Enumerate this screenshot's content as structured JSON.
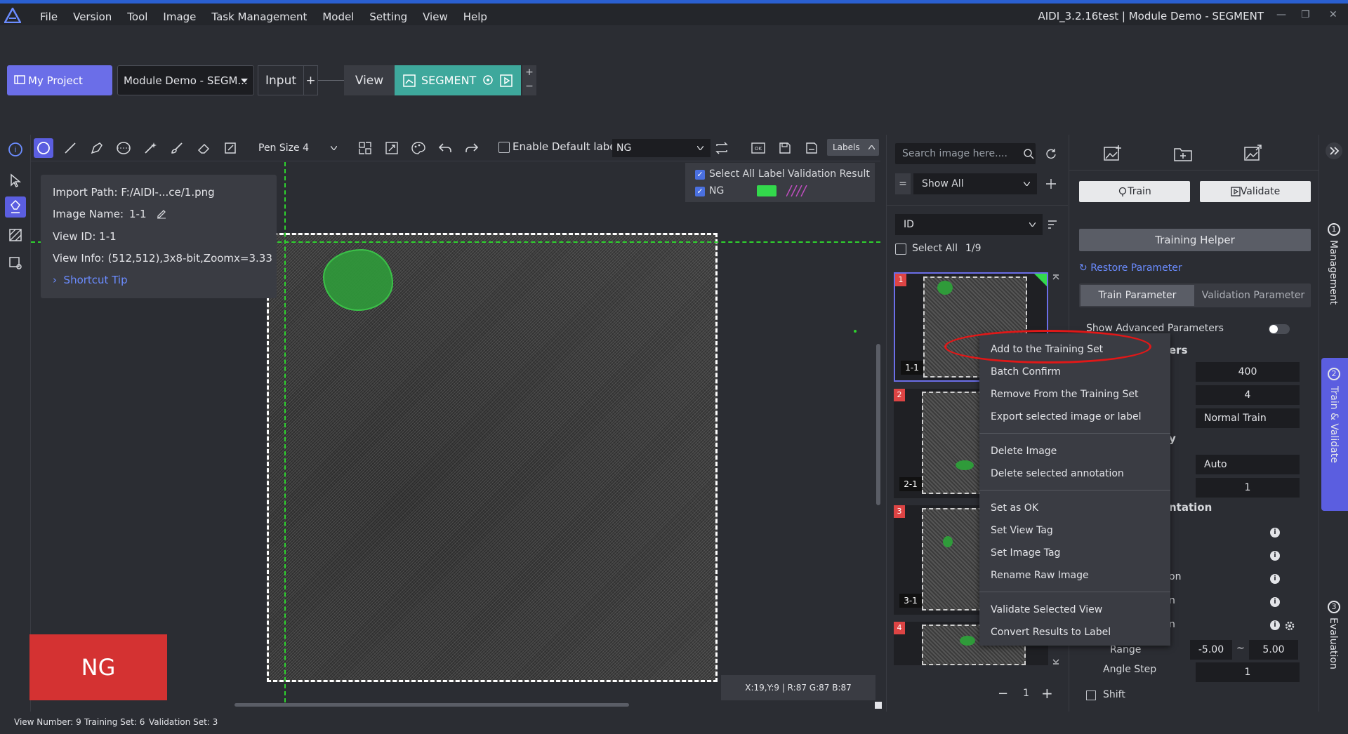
{
  "titlebar": {
    "menu": [
      "File",
      "Version",
      "Tool",
      "Image",
      "Task Management",
      "Model",
      "Setting",
      "View",
      "Help"
    ],
    "window_title": "AIDI_3.2.16test | Module Demo - SEGMENT",
    "min": "—",
    "restore": "❐",
    "close": "✕"
  },
  "project": {
    "my_project": "My Project",
    "module_select": "Module Demo - SEGM...",
    "input": "Input",
    "plus": "+",
    "view": "View",
    "segment": "SEGMENT",
    "zoom_plus": "+",
    "zoom_minus": "−"
  },
  "toolbar": {
    "pen_size": "Pen Size 4",
    "enable_default_label": "Enable Default label",
    "default_label": "NG",
    "labels_button": "Labels"
  },
  "labels_panel": {
    "select_all": "Select All",
    "label": "Label",
    "validation_result": "Validation Result",
    "ng": "NG",
    "label_color": "#33d94c"
  },
  "info": {
    "import_path": "Import Path: F:/AIDI-...ce/1.png",
    "image_name_label": "Image Name:",
    "image_name": "1-1",
    "view_id": "View ID: 1-1",
    "view_info": "View Info: (512,512),3x8-bit,Zoomx=3.33",
    "shortcut_tip": "Shortcut Tip"
  },
  "result_badge": "NG",
  "coords": "X:19,Y:9  |  R:87 G:87 B:87",
  "statusbar": {
    "view_number": "View Number: 9",
    "training_set": "Training Set: 6",
    "validation_set": "Validation Set: 3"
  },
  "image_list": {
    "search_placeholder": "Search image here....",
    "filter_eq": "=",
    "show_all": "Show All",
    "sort_by": "ID",
    "select_all": "Select All",
    "count": "1/9",
    "thumbs": [
      {
        "num": "1",
        "id": "1-1"
      },
      {
        "num": "2",
        "id": "2-1"
      },
      {
        "num": "3",
        "id": "3-1"
      },
      {
        "num": "4",
        "id": ""
      }
    ],
    "page": "1",
    "page_minus": "−",
    "page_plus": "+"
  },
  "context_menu": {
    "group1": [
      "Add to the Training Set",
      "Batch Confirm",
      "Remove From the Training Set",
      "Export selected image or label"
    ],
    "group2": [
      "Delete Image",
      "Delete selected annotation"
    ],
    "group3": [
      "Set as OK",
      "Set View Tag",
      "Set Image Tag",
      "Rename Raw Image"
    ],
    "group4": [
      "Validate Selected View",
      "Convert Results to Label"
    ]
  },
  "right_panel": {
    "train": "Train",
    "validate": "Validate",
    "training_helper": "Training Helper",
    "restore_parameter": "Restore Parameter",
    "train_parameter": "Train Parameter",
    "validation_parameter": "Validation Parameter",
    "show_advanced": "Show Advanced Parameters",
    "params_header_tail": "ers",
    "val_400": "400",
    "val_4": "4",
    "normal_train": "Normal Train",
    "section_tail_y": "y",
    "auto": "Auto",
    "val_1": "1",
    "section_tail_ntation": "ntation",
    "tail_on": "on",
    "tail_n1": "n",
    "tail_n2": "n",
    "range_label": "Range",
    "range_min": "-5.00",
    "range_tilde": "~",
    "range_max": "5.00",
    "angle_step": "Angle Step",
    "angle_val": "1",
    "shift": "Shift"
  },
  "side_nav": {
    "management": "Management",
    "train_validate": "Train & Validate",
    "evaluation": "Evaluation",
    "n1": "1",
    "n2": "2",
    "n3": "3"
  }
}
